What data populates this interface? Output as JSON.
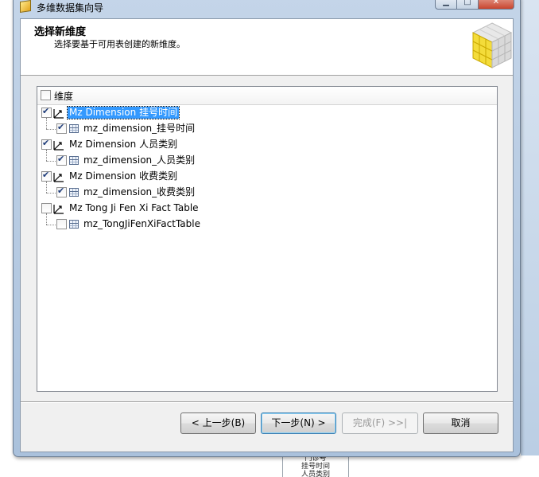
{
  "window": {
    "title": "多维数据集向导",
    "minimize_glyph": "▁",
    "maximize_glyph": "□",
    "close_glyph": "✕"
  },
  "header": {
    "title": "选择新维度",
    "subtitle": "选择要基于可用表创建的新维度。"
  },
  "panel": {
    "column_header": "维度",
    "column_checked": false
  },
  "tree": [
    {
      "type": "dimension",
      "label": "Mz Dimension 挂号时间",
      "checked": true,
      "selected": true,
      "child": {
        "type": "table",
        "label": "mz_dimension_挂号时间",
        "checked": true
      }
    },
    {
      "type": "dimension",
      "label": "Mz Dimension 人员类别",
      "checked": true,
      "selected": false,
      "child": {
        "type": "table",
        "label": "mz_dimension_人员类别",
        "checked": true
      }
    },
    {
      "type": "dimension",
      "label": "Mz Dimension 收费类别",
      "checked": true,
      "selected": false,
      "child": {
        "type": "table",
        "label": "mz_dimension_收费类别",
        "checked": true
      }
    },
    {
      "type": "dimension",
      "label": "Mz Tong Ji Fen Xi Fact Table",
      "checked": false,
      "selected": false,
      "child": {
        "type": "table",
        "label": "mz_TongJiFenXiFactTable",
        "checked": false
      }
    }
  ],
  "buttons": {
    "back": "< 上一步(B)",
    "next": "下一步(N) >",
    "finish": "完成(F) >>|",
    "cancel": "取消"
  },
  "background_doc": {
    "line1": "门诊号",
    "line2": "挂号时间",
    "line3": "人员类别"
  },
  "colors": {
    "selection": "#3399ff",
    "accent_cube": "#f2d21c"
  }
}
